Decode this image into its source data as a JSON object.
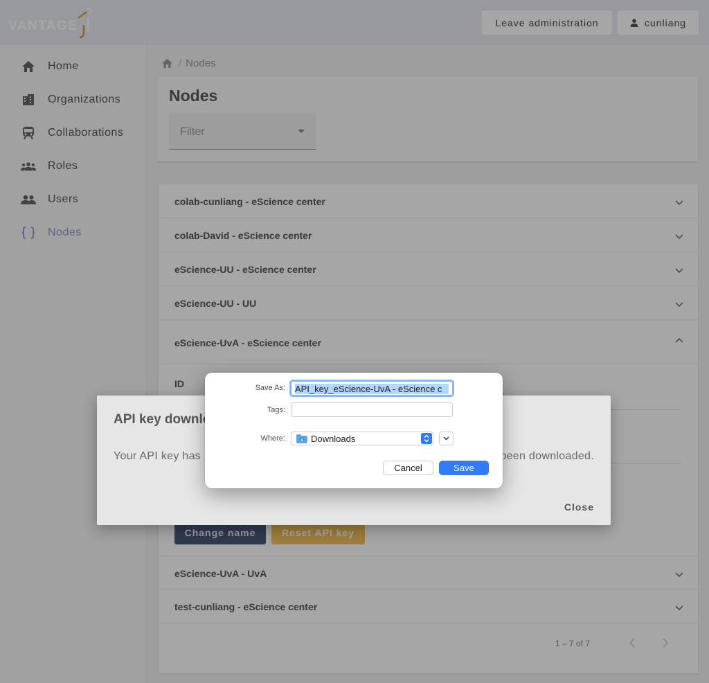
{
  "header": {
    "logo_text": "VANTAGE",
    "leave_button": "Leave administration",
    "user_button": "cunliang",
    "user_icon": "person-icon"
  },
  "sidebar": {
    "items": [
      {
        "label": "Home",
        "icon": "home-icon"
      },
      {
        "label": "Organizations",
        "icon": "building-icon"
      },
      {
        "label": "Collaborations",
        "icon": "train-icon"
      },
      {
        "label": "Roles",
        "icon": "group-icon"
      },
      {
        "label": "Users",
        "icon": "people-icon"
      },
      {
        "label": "Nodes",
        "icon": "braces-icon",
        "active": true
      }
    ]
  },
  "breadcrumb": {
    "separator": "/",
    "current": "Nodes"
  },
  "page": {
    "title": "Nodes",
    "filter_label": "Filter"
  },
  "nodes": {
    "rows": [
      "colab-cunliang - eScience center",
      "colab-David - eScience center",
      "eScience-UU - eScience center",
      "eScience-UU - UU",
      "eScience-UvA - eScience center",
      "eScience-UvA - UvA",
      "test-cunliang - eScience center"
    ],
    "expanded_field_label": "ID",
    "change_name_button": "Change name",
    "reset_key_button": "Reset API key",
    "pagination": "1 – 7 of 7"
  },
  "api_dialog": {
    "title_visible": "API key downlo",
    "text_left": "Your API key has",
    "text_right": "been downloaded.",
    "close_button": "Close"
  },
  "save_sheet": {
    "save_as_label": "Save As:",
    "save_as_value": "API_key_eScience-UvA - eScience c",
    "tags_label": "Tags:",
    "tags_value": "",
    "where_label": "Where:",
    "where_value": "Downloads",
    "cancel_button": "Cancel",
    "save_button": "Save",
    "accent_color": "#2f7cf6"
  }
}
